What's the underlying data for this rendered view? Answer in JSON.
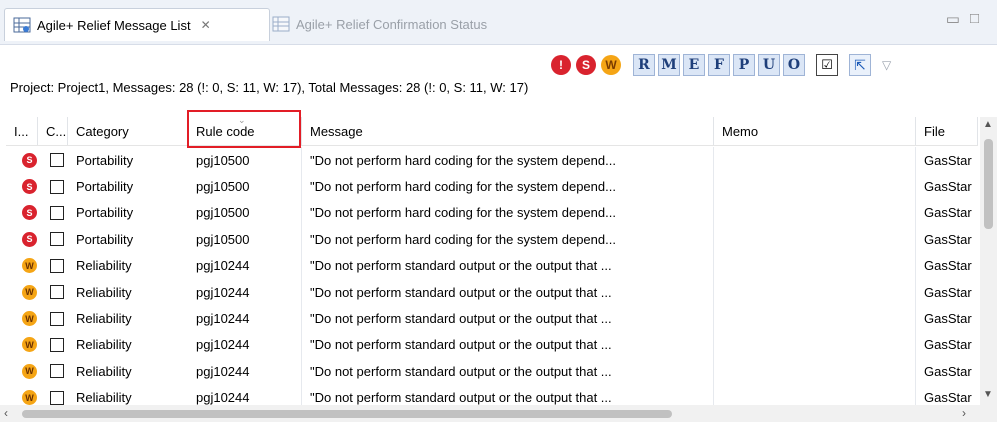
{
  "tabs": [
    {
      "label": "Agile+ Relief Message List",
      "icon": "table-icon",
      "active": true
    },
    {
      "label": "Agile+ Relief Confirmation Status",
      "icon": "table-icon",
      "active": false
    }
  ],
  "toolbar": {
    "filters": [
      {
        "glyph": "!",
        "name": "error-filter"
      },
      {
        "glyph": "S",
        "name": "s-filter"
      },
      {
        "glyph": "W",
        "name": "w-filter"
      }
    ],
    "letters": [
      "R",
      "M",
      "E",
      "F",
      "P",
      "U",
      "O"
    ],
    "check_glyph": "☑",
    "export_glyph": "⇱",
    "menu_glyph": "▽"
  },
  "summary": "Project: Project1,  Messages: 28 (!: 0, S: 11, W: 17),  Total Messages: 28 (!: 0, S: 11, W: 17)",
  "columns": {
    "i": "I...",
    "c": "C...",
    "category": "Category",
    "rule": "Rule code",
    "message": "Message",
    "memo": "Memo",
    "file": "File"
  },
  "rows": [
    {
      "sev": "S",
      "category": "Portability",
      "rule": "pgj10500",
      "message": "\"Do not perform hard coding for the system depend...",
      "memo": "",
      "file": "GasStar"
    },
    {
      "sev": "S",
      "category": "Portability",
      "rule": "pgj10500",
      "message": "\"Do not perform hard coding for the system depend...",
      "memo": "",
      "file": "GasStar"
    },
    {
      "sev": "S",
      "category": "Portability",
      "rule": "pgj10500",
      "message": "\"Do not perform hard coding for the system depend...",
      "memo": "",
      "file": "GasStar"
    },
    {
      "sev": "S",
      "category": "Portability",
      "rule": "pgj10500",
      "message": "\"Do not perform hard coding for the system depend...",
      "memo": "",
      "file": "GasStar"
    },
    {
      "sev": "W",
      "category": "Reliability",
      "rule": "pgj10244",
      "message": "\"Do not perform standard output or the output that ...",
      "memo": "",
      "file": "GasStar"
    },
    {
      "sev": "W",
      "category": "Reliability",
      "rule": "pgj10244",
      "message": "\"Do not perform standard output or the output that ...",
      "memo": "",
      "file": "GasStar"
    },
    {
      "sev": "W",
      "category": "Reliability",
      "rule": "pgj10244",
      "message": "\"Do not perform standard output or the output that ...",
      "memo": "",
      "file": "GasStar"
    },
    {
      "sev": "W",
      "category": "Reliability",
      "rule": "pgj10244",
      "message": "\"Do not perform standard output or the output that ...",
      "memo": "",
      "file": "GasStar"
    },
    {
      "sev": "W",
      "category": "Reliability",
      "rule": "pgj10244",
      "message": "\"Do not perform standard output or the output that ...",
      "memo": "",
      "file": "GasStar"
    },
    {
      "sev": "W",
      "category": "Reliability",
      "rule": "pgj10244",
      "message": "\"Do not perform standard output or the output that ...",
      "memo": "",
      "file": "GasStar"
    }
  ],
  "colors": {
    "severe": "#d9232e",
    "warning": "#f5a515",
    "highlight": "#e21d26"
  }
}
